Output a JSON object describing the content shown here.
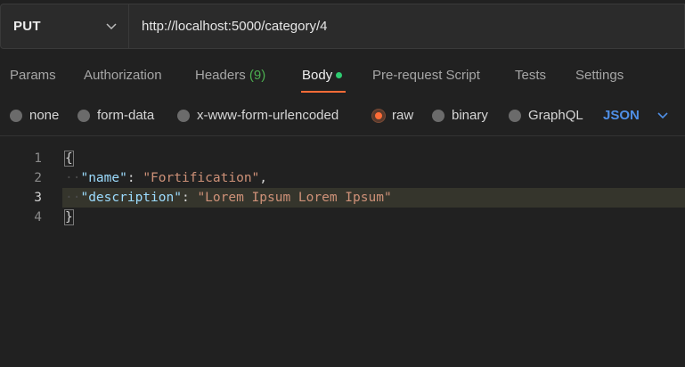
{
  "request": {
    "method": "PUT",
    "url": "http://localhost:5000/category/4"
  },
  "tabs": [
    {
      "label": "Params"
    },
    {
      "label": "Authorization"
    },
    {
      "label": "Headers",
      "count": "(9)"
    },
    {
      "label": "Body"
    },
    {
      "label": "Pre-request Script"
    },
    {
      "label": "Tests"
    },
    {
      "label": "Settings"
    }
  ],
  "body_types": [
    {
      "label": "none"
    },
    {
      "label": "form-data"
    },
    {
      "label": "x-www-form-urlencoded"
    },
    {
      "label": "raw"
    },
    {
      "label": "binary"
    },
    {
      "label": "GraphQL"
    }
  ],
  "selected_body_type": "raw",
  "format": "JSON",
  "editor": {
    "line_numbers": [
      "1",
      "2",
      "3",
      "4"
    ],
    "open_brace": "{",
    "close_brace": "}",
    "name_key": "\"name\"",
    "name_value": "\"Fortification\"",
    "description_key": "\"description\"",
    "description_value": "\"Lorem Ipsum Lorem Ipsum\""
  },
  "colors": {
    "accent": "#ff6c37",
    "json_key": "#9cdcfe",
    "json_string": "#ce9178",
    "format_link": "#4f8fe6",
    "status_dot": "#2ecc71"
  },
  "icons": {
    "method_dropdown": "chevron-down-icon",
    "format_dropdown": "chevron-down-icon"
  }
}
